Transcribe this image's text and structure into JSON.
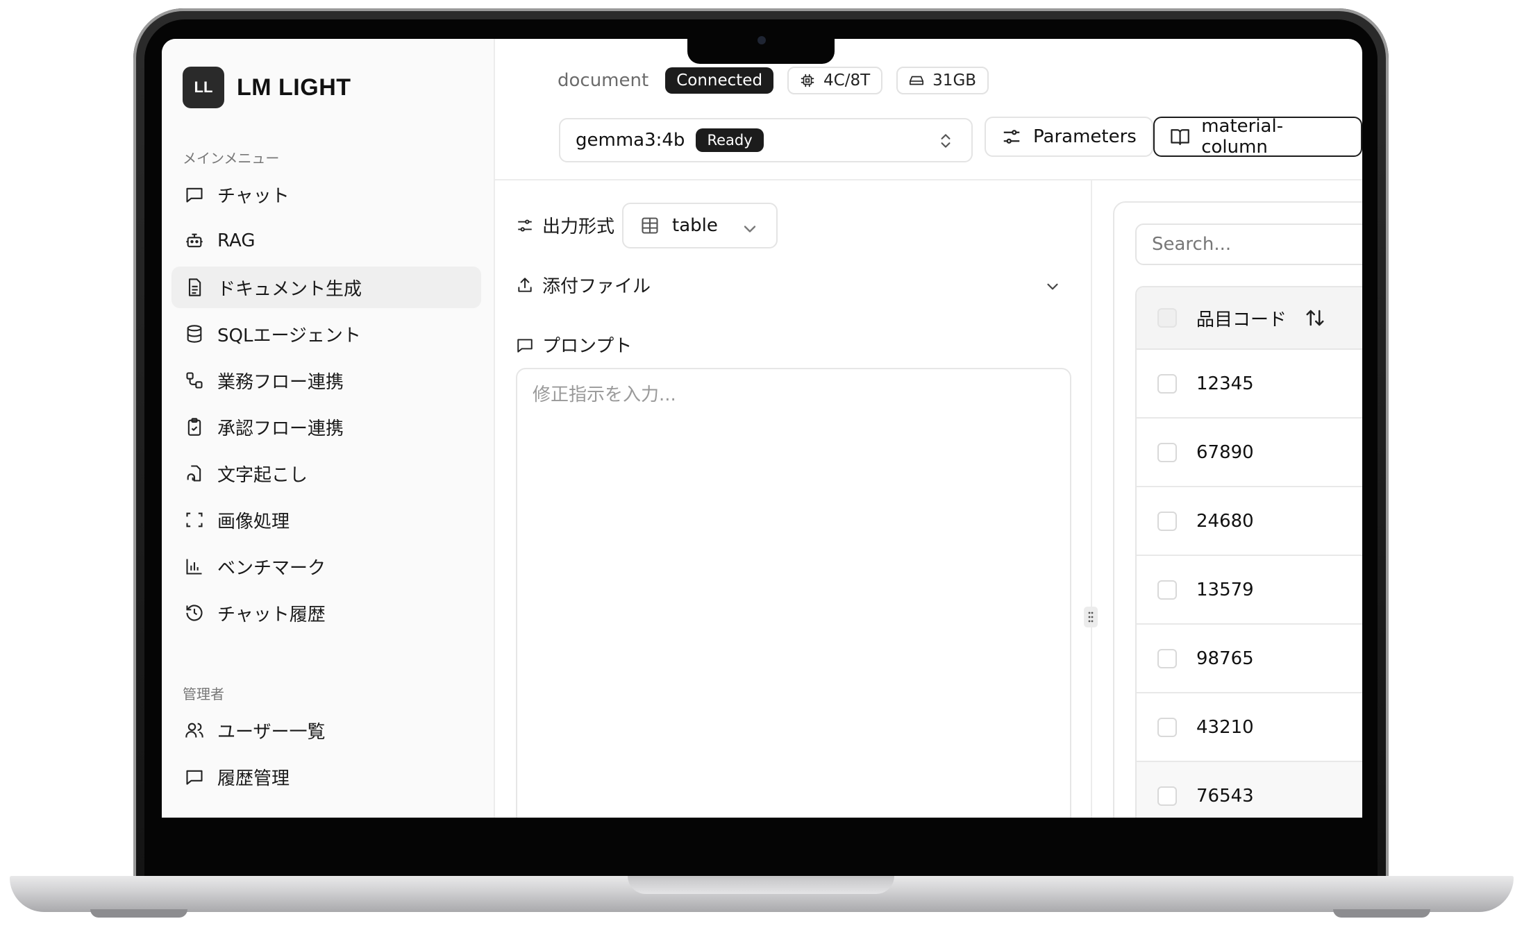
{
  "app": {
    "logo_initials": "LL",
    "name": "LM LIGHT"
  },
  "sidebar": {
    "main_section_label": "メインメニュー",
    "items": [
      {
        "label": "チャット",
        "icon": "chat-icon"
      },
      {
        "label": "RAG",
        "icon": "robot-icon"
      },
      {
        "label": "ドキュメント生成",
        "icon": "file-text-icon",
        "active": true
      },
      {
        "label": "SQLエージェント",
        "icon": "database-icon"
      },
      {
        "label": "業務フロー連携",
        "icon": "workflow-icon"
      },
      {
        "label": "承認フロー連携",
        "icon": "clipboard-check-icon"
      },
      {
        "label": "文字起こし",
        "icon": "audio-file-icon"
      },
      {
        "label": "画像処理",
        "icon": "scan-icon"
      },
      {
        "label": "ベンチマーク",
        "icon": "bar-chart-icon"
      },
      {
        "label": "チャット履歴",
        "icon": "history-icon"
      }
    ],
    "admin_section_label": "管理者",
    "admin_items": [
      {
        "label": "ユーザー一覧",
        "icon": "users-icon"
      },
      {
        "label": "履歴管理",
        "icon": "message-square-icon"
      }
    ]
  },
  "header": {
    "page_label": "document",
    "status_badge": "Connected",
    "cpu_label": "4C/8T",
    "memory_label": "31GB",
    "model": {
      "name": "gemma3:4b",
      "status": "Ready"
    },
    "parameters_button": "Parameters",
    "template_button": "material-column"
  },
  "form": {
    "output_format_label": "出力形式",
    "output_format_value": "table",
    "attachments_label": "添付ファイル",
    "prompt_label": "プロンプト",
    "prompt_placeholder": "修正指示を入力..."
  },
  "data_panel": {
    "search_placeholder": "Search...",
    "column_header": "品目コード",
    "rows": [
      "12345",
      "67890",
      "24680",
      "13579",
      "98765",
      "43210",
      "76543"
    ]
  },
  "colors": {
    "accent": "#1c1c1c",
    "sidebar_bg": "#fafafa",
    "active_item_bg": "#efefef",
    "border": "#e4e4e4"
  }
}
